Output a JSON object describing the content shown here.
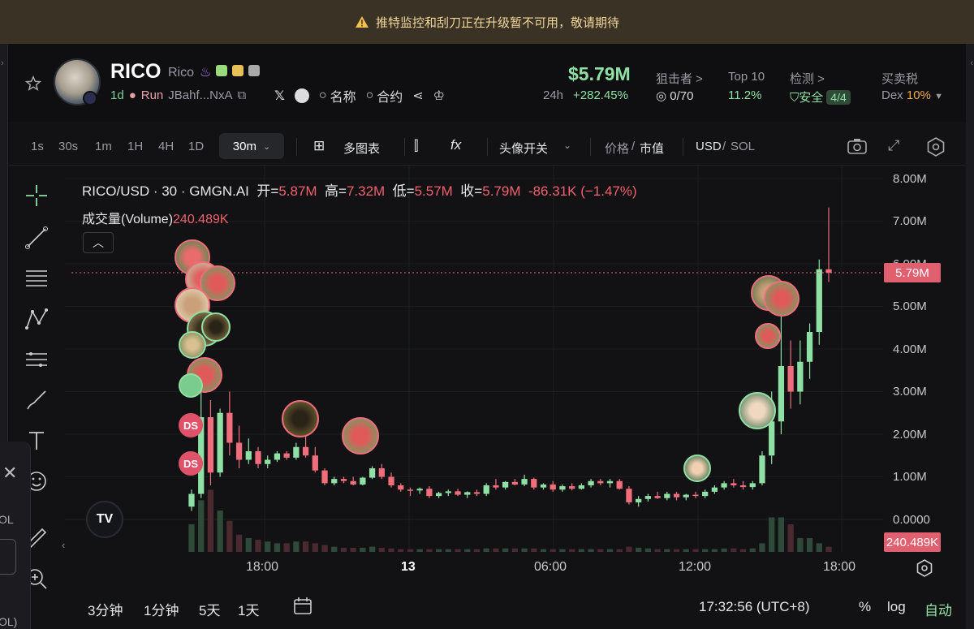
{
  "banner": {
    "text": "推特监控和刮刀正在升级暂不可用，敬请期待"
  },
  "token": {
    "symbol": "RICO",
    "name": "Rico",
    "age": "1d",
    "platform": "Run",
    "address": "JBahf...NxA",
    "search_name": "名称",
    "search_contract": "合约"
  },
  "stats": {
    "market_cap": "$5.79M",
    "change_label": "24h",
    "change_value": "+282.45%",
    "sniper_label": "狙击者 >",
    "sniper_value": "0/70",
    "top10_label": "Top 10",
    "top10_value": "11.2%",
    "check_label": "检测 >",
    "check_value": "安全",
    "check_badge": "4/4",
    "tax_label": "买卖税",
    "tax_prefix": "Dex",
    "tax_value": "10%"
  },
  "toolbar": {
    "intervals": [
      "1s",
      "30s",
      "1m",
      "1H",
      "4H",
      "1D"
    ],
    "active_interval": "30m",
    "multi_chart": "多图表",
    "avatar_switch": "头像开关",
    "price_label": "价格",
    "mcap_label": "市值",
    "usd_label": "USD",
    "sol_label": "SOL"
  },
  "legend": {
    "pair": "RICO/USD · 30 · GMGN.AI",
    "open_label": "开=",
    "open": "5.87M",
    "high_label": "高=",
    "high": "7.32M",
    "low_label": "低=",
    "low": "5.57M",
    "close_label": "收=",
    "close": "5.79M",
    "change": "-86.31K (−1.47%)",
    "volume_label": "成交量(Volume)",
    "volume_value": "240.489K"
  },
  "chart_data": {
    "type": "candlestick",
    "y_ticks": [
      "8.00M",
      "7.00M",
      "6.00M",
      "5.00M",
      "4.00M",
      "3.00M",
      "2.00M",
      "1.00M",
      "0.0000"
    ],
    "ylim": [
      0,
      8000000
    ],
    "x_ticks": [
      "18:00",
      "13",
      "06:00",
      "12:00",
      "18:00"
    ],
    "last_price_tag": "5.79M",
    "last_volume_tag": "240.489K",
    "candles": [
      {
        "o": 0.3,
        "h": 0.7,
        "l": 0.2,
        "c": 0.6
      },
      {
        "o": 0.6,
        "h": 3.2,
        "l": 0.5,
        "c": 2.4
      },
      {
        "o": 2.4,
        "h": 2.8,
        "l": 0.8,
        "c": 1.1
      },
      {
        "o": 1.1,
        "h": 2.6,
        "l": 1.0,
        "c": 2.5
      },
      {
        "o": 2.5,
        "h": 3.0,
        "l": 1.5,
        "c": 1.8
      },
      {
        "o": 1.8,
        "h": 2.2,
        "l": 1.2,
        "c": 1.4
      },
      {
        "o": 1.4,
        "h": 1.9,
        "l": 1.3,
        "c": 1.6
      },
      {
        "o": 1.6,
        "h": 1.7,
        "l": 1.2,
        "c": 1.3
      },
      {
        "o": 1.3,
        "h": 1.5,
        "l": 1.2,
        "c": 1.4
      },
      {
        "o": 1.4,
        "h": 1.6,
        "l": 1.35,
        "c": 1.55
      },
      {
        "o": 1.55,
        "h": 1.6,
        "l": 1.4,
        "c": 1.45
      },
      {
        "o": 1.45,
        "h": 1.8,
        "l": 1.4,
        "c": 1.7
      },
      {
        "o": 1.7,
        "h": 2.0,
        "l": 1.45,
        "c": 1.5
      },
      {
        "o": 1.5,
        "h": 1.7,
        "l": 1.1,
        "c": 1.15
      },
      {
        "o": 1.15,
        "h": 1.2,
        "l": 0.8,
        "c": 0.85
      },
      {
        "o": 0.85,
        "h": 1.0,
        "l": 0.8,
        "c": 0.95
      },
      {
        "o": 0.95,
        "h": 1.0,
        "l": 0.85,
        "c": 0.9
      },
      {
        "o": 0.9,
        "h": 1.0,
        "l": 0.8,
        "c": 0.82
      },
      {
        "o": 0.82,
        "h": 1.0,
        "l": 0.8,
        "c": 0.98
      },
      {
        "o": 0.98,
        "h": 1.25,
        "l": 0.95,
        "c": 1.2
      },
      {
        "o": 1.2,
        "h": 1.3,
        "l": 0.95,
        "c": 1.0
      },
      {
        "o": 1.0,
        "h": 1.1,
        "l": 0.75,
        "c": 0.8
      },
      {
        "o": 0.8,
        "h": 0.85,
        "l": 0.65,
        "c": 0.7
      },
      {
        "o": 0.7,
        "h": 0.75,
        "l": 0.55,
        "c": 0.68
      },
      {
        "o": 0.68,
        "h": 0.75,
        "l": 0.6,
        "c": 0.72
      },
      {
        "o": 0.72,
        "h": 0.78,
        "l": 0.5,
        "c": 0.55
      },
      {
        "o": 0.55,
        "h": 0.65,
        "l": 0.5,
        "c": 0.62
      },
      {
        "o": 0.62,
        "h": 0.7,
        "l": 0.55,
        "c": 0.66
      },
      {
        "o": 0.66,
        "h": 0.72,
        "l": 0.55,
        "c": 0.58
      },
      {
        "o": 0.58,
        "h": 0.66,
        "l": 0.5,
        "c": 0.64
      },
      {
        "o": 0.64,
        "h": 0.7,
        "l": 0.55,
        "c": 0.6
      },
      {
        "o": 0.6,
        "h": 0.85,
        "l": 0.55,
        "c": 0.8
      },
      {
        "o": 0.8,
        "h": 0.95,
        "l": 0.7,
        "c": 0.75
      },
      {
        "o": 0.75,
        "h": 0.9,
        "l": 0.7,
        "c": 0.88
      },
      {
        "o": 0.88,
        "h": 0.95,
        "l": 0.8,
        "c": 0.82
      },
      {
        "o": 0.82,
        "h": 1.05,
        "l": 0.78,
        "c": 0.95
      },
      {
        "o": 0.95,
        "h": 0.98,
        "l": 0.7,
        "c": 0.75
      },
      {
        "o": 0.75,
        "h": 0.85,
        "l": 0.7,
        "c": 0.82
      },
      {
        "o": 0.82,
        "h": 0.9,
        "l": 0.65,
        "c": 0.7
      },
      {
        "o": 0.7,
        "h": 0.82,
        "l": 0.65,
        "c": 0.78
      },
      {
        "o": 0.78,
        "h": 0.85,
        "l": 0.68,
        "c": 0.72
      },
      {
        "o": 0.72,
        "h": 0.85,
        "l": 0.7,
        "c": 0.8
      },
      {
        "o": 0.8,
        "h": 0.95,
        "l": 0.75,
        "c": 0.9
      },
      {
        "o": 0.9,
        "h": 0.95,
        "l": 0.8,
        "c": 0.85
      },
      {
        "o": 0.85,
        "h": 0.95,
        "l": 0.75,
        "c": 0.9
      },
      {
        "o": 0.9,
        "h": 0.95,
        "l": 0.7,
        "c": 0.72
      },
      {
        "o": 0.72,
        "h": 0.78,
        "l": 0.35,
        "c": 0.4
      },
      {
        "o": 0.4,
        "h": 0.55,
        "l": 0.3,
        "c": 0.48
      },
      {
        "o": 0.48,
        "h": 0.6,
        "l": 0.42,
        "c": 0.55
      },
      {
        "o": 0.55,
        "h": 0.65,
        "l": 0.48,
        "c": 0.5
      },
      {
        "o": 0.5,
        "h": 0.65,
        "l": 0.45,
        "c": 0.6
      },
      {
        "o": 0.6,
        "h": 0.65,
        "l": 0.45,
        "c": 0.52
      },
      {
        "o": 0.52,
        "h": 0.6,
        "l": 0.45,
        "c": 0.58
      },
      {
        "o": 0.58,
        "h": 0.65,
        "l": 0.5,
        "c": 0.55
      },
      {
        "o": 0.55,
        "h": 0.7,
        "l": 0.5,
        "c": 0.65
      },
      {
        "o": 0.65,
        "h": 0.8,
        "l": 0.6,
        "c": 0.75
      },
      {
        "o": 0.75,
        "h": 0.9,
        "l": 0.7,
        "c": 0.85
      },
      {
        "o": 0.85,
        "h": 0.95,
        "l": 0.75,
        "c": 0.8
      },
      {
        "o": 0.8,
        "h": 0.9,
        "l": 0.7,
        "c": 0.76
      },
      {
        "o": 0.76,
        "h": 0.9,
        "l": 0.7,
        "c": 0.85
      },
      {
        "o": 0.85,
        "h": 1.6,
        "l": 0.8,
        "c": 1.5
      },
      {
        "o": 1.5,
        "h": 3.0,
        "l": 1.3,
        "c": 2.3
      },
      {
        "o": 2.3,
        "h": 5.0,
        "l": 2.0,
        "c": 3.6
      },
      {
        "o": 3.6,
        "h": 4.2,
        "l": 2.6,
        "c": 3.0
      },
      {
        "o": 3.0,
        "h": 4.2,
        "l": 2.7,
        "c": 3.7
      },
      {
        "o": 3.7,
        "h": 4.6,
        "l": 3.3,
        "c": 4.4
      },
      {
        "o": 4.4,
        "h": 6.1,
        "l": 4.1,
        "c": 5.87
      },
      {
        "o": 5.87,
        "h": 7.32,
        "l": 5.57,
        "c": 5.79
      }
    ],
    "volumes": [
      0.8,
      1.5,
      1.8,
      1.2,
      0.9,
      0.5,
      0.4,
      0.35,
      0.3,
      0.25,
      0.25,
      0.3,
      0.3,
      0.25,
      0.2,
      0.15,
      0.12,
      0.12,
      0.12,
      0.15,
      0.12,
      0.1,
      0.08,
      0.08,
      0.08,
      0.08,
      0.08,
      0.08,
      0.08,
      0.08,
      0.08,
      0.1,
      0.1,
      0.1,
      0.1,
      0.1,
      0.1,
      0.08,
      0.08,
      0.08,
      0.08,
      0.08,
      0.08,
      0.08,
      0.08,
      0.08,
      0.15,
      0.12,
      0.1,
      0.08,
      0.08,
      0.08,
      0.08,
      0.08,
      0.08,
      0.08,
      0.1,
      0.1,
      0.08,
      0.1,
      0.25,
      1.0,
      1.0,
      0.8,
      0.4,
      0.4,
      0.25,
      0.15
    ],
    "volume_ylim": [
      0,
      2.0
    ],
    "colors": {
      "up": "#8fe0a4",
      "down": "#f06d7c"
    }
  },
  "bottom": {
    "r1": "3分钟",
    "r2": "1分钟",
    "r3": "5天",
    "r4": "1天",
    "time": "17:32:56 (UTC+8)",
    "pct": "%",
    "log": "log",
    "auto": "自动"
  },
  "side_panel": {
    "sol_top": "OL",
    "sol_bottom": "OL)"
  }
}
